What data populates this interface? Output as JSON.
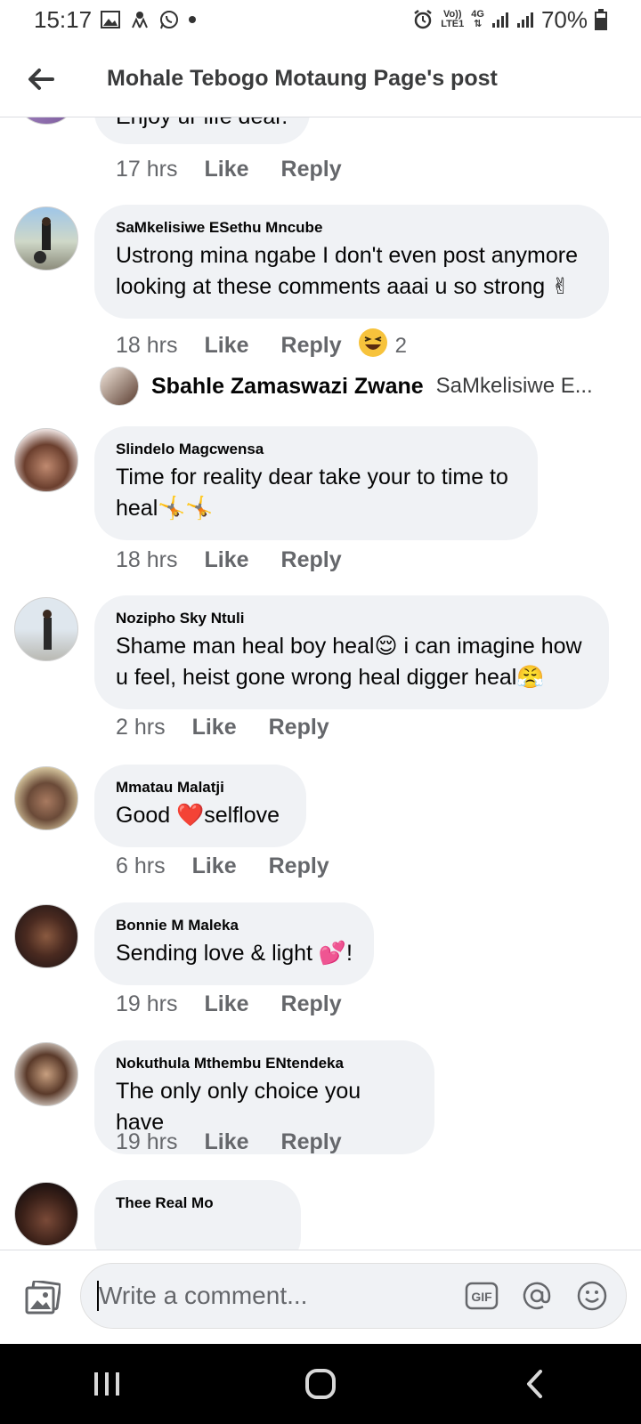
{
  "status_bar": {
    "time": "15:17",
    "network_top": "Vo))",
    "network_bottom": "LTE1",
    "network_type": "4G",
    "battery": "70%"
  },
  "header": {
    "title": "Mohale Tebogo Motaung Page's post"
  },
  "partial_top_comment": {
    "text": "Enjoy ur life dear.",
    "time": "17 hrs",
    "like_label": "Like",
    "reply_label": "Reply"
  },
  "comments": [
    {
      "author": "SaMkelisiwe ESethu Mncube",
      "text": "Ustrong mina ngabe I don't even post anymore looking at these comments aaai u so strong ✌",
      "time": "18 hrs",
      "like_label": "Like",
      "reply_label": "Reply",
      "reaction_count": "2",
      "reply_preview": {
        "author": "Sbahle Zamaswazi Zwane",
        "text": "SaMkelisiwe E..."
      }
    },
    {
      "author": "Slindelo Magcwensa",
      "text": "Time for reality dear take your to time to heal🤸🤸",
      "time": "18 hrs",
      "like_label": "Like",
      "reply_label": "Reply"
    },
    {
      "author": "Nozipho Sky Ntuli",
      "text": "Shame man heal boy heal😌 i can imagine how u feel, heist gone wrong heal digger heal😤",
      "time": "2 hrs",
      "like_label": "Like",
      "reply_label": "Reply"
    },
    {
      "author": "Mmatau Malatji",
      "text": "Good ❤️selflove",
      "time": "6 hrs",
      "like_label": "Like",
      "reply_label": "Reply"
    },
    {
      "author": "Bonnie M Maleka",
      "text": "Sending love & light 💕!",
      "time": "19 hrs",
      "like_label": "Like",
      "reply_label": "Reply"
    },
    {
      "author": "Nokuthula Mthembu ENtendeka",
      "text": "The only only choice you have",
      "time": "19 hrs",
      "like_label": "Like",
      "reply_label": "Reply"
    },
    {
      "author": "Thee Real Mo",
      "text": "",
      "time": "",
      "like_label": "",
      "reply_label": ""
    }
  ],
  "composer": {
    "placeholder": "Write a comment...",
    "gif_label": "GIF"
  },
  "colors": {
    "bubble": "#f0f2f5",
    "meta": "#65676b",
    "text": "#050505"
  }
}
